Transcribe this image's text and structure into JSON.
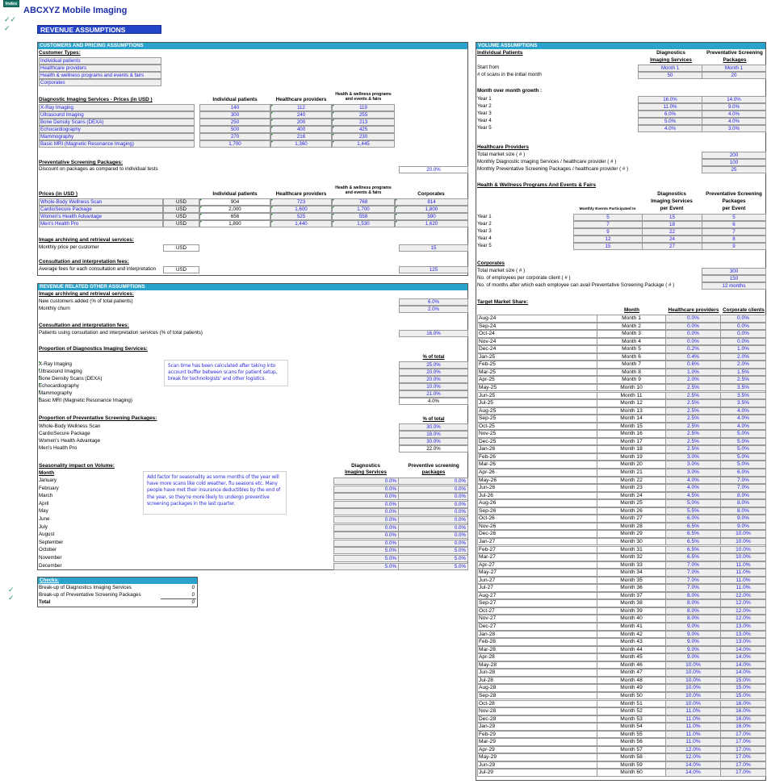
{
  "app": {
    "index_button": "Index",
    "title": "ABCXYZ Mobile Imaging",
    "section_title": "REVENUE ASSUMPTIONS",
    "check_icon": "checkmark-icon"
  },
  "customers_pricing": {
    "header": "CUSTOMERS AND PRICING ASSUMPTIONS",
    "customer_types_title": "Customer Types:",
    "customer_types": [
      "Individual patients",
      "Healthcare providers",
      "Health & wellness programs and events & fairs",
      "Corporates"
    ],
    "diagnostic": {
      "title": "Diagnostic Imaging Services - Prices (in USD )",
      "columns": [
        "Individual patients",
        "Healthcare providers",
        "Health & wellness programs and events & fairs"
      ],
      "rows": [
        {
          "service": "X-Ray Imaging",
          "values": [
            "140",
            "112",
            "119"
          ]
        },
        {
          "service": "Ultrasound Imaging",
          "values": [
            "300",
            "240",
            "255"
          ]
        },
        {
          "service": "Bone Density Scans (DEXA)",
          "values": [
            "250",
            "200",
            "213"
          ]
        },
        {
          "service": "Echocardiography",
          "values": [
            "500",
            "400",
            "425"
          ]
        },
        {
          "service": "Mammography",
          "values": [
            "270",
            "216",
            "230"
          ]
        },
        {
          "service": "Basic MRI (Magnetic Resonance Imaging)",
          "values": [
            "1,700",
            "1,360",
            "1,445"
          ]
        }
      ]
    },
    "packages": {
      "title": "Preventative Screening Packages:",
      "discount_label": "Discount on packages as compared to individual tests",
      "discount_value": "20.0%"
    },
    "prices": {
      "title": "Prices (in USD )",
      "columns": [
        "Individual patients",
        "Healthcare providers",
        "Health & wellness programs and events & fairs",
        "Corporates"
      ],
      "rows": [
        {
          "package": "Whole-Body Wellness Scan",
          "currency": "USD",
          "values": [
            "904",
            "723",
            "768",
            "814"
          ]
        },
        {
          "package": "CardioSecure Package",
          "currency": "USD",
          "values": [
            "2,000",
            "1,600",
            "1,700",
            "1,800"
          ]
        },
        {
          "package": "Women's Health Advantage",
          "currency": "USD",
          "values": [
            "656",
            "525",
            "558",
            "590"
          ]
        },
        {
          "package": "Men's Health Pro",
          "currency": "USD",
          "values": [
            "1,800",
            "1,440",
            "1,530",
            "1,620"
          ]
        }
      ]
    },
    "archiving": {
      "title": "Image archiving and retrieval services:",
      "label": "Monthly price per customer",
      "currency": "USD",
      "value": "15"
    },
    "consultation": {
      "title": "Consultation and interpretation fees:",
      "label": "Average fees for each consultation and interpretation",
      "currency": "USD",
      "value": "125"
    }
  },
  "other_assumptions": {
    "header": "REVENUE RELATED OTHER ASSUMPTIONS",
    "archiving": {
      "title": "Image archiving and retrieval services:",
      "rows": [
        {
          "label": "New customers added (% of total patients)",
          "value": "6.0%"
        },
        {
          "label": "Monthly churn",
          "value": "2.0%"
        }
      ]
    },
    "consultation": {
      "title": "Consultation and interpretation fees:",
      "label": "Patients using consultation and interpretation services  (% of total patients)",
      "value": "16.0%"
    },
    "diag_proportion": {
      "title": "Proportion of Diagnostics Imaging Services:",
      "col_header": "% of total",
      "rows": [
        {
          "label": "X-Ray Imaging",
          "value": "25.0%"
        },
        {
          "label": "Ultrasound Imaging",
          "value": "20.0%"
        },
        {
          "label": "Bone Density Scans (DEXA)",
          "value": "20.0%"
        },
        {
          "label": "Echocardiography",
          "value": "10.0%"
        },
        {
          "label": "Mammography",
          "value": "21.0%"
        },
        {
          "label": "Basic MRI (Magnetic Resonance Imaging)",
          "value": "4.0%"
        }
      ],
      "note": "Scan time has been calculated  after taking into account buffer between scans for patient setup, break for technologists' and other logistics."
    },
    "pkg_proportion": {
      "title": "Proportion of Preventative Screening Packages:",
      "col_header": "% of total",
      "rows": [
        {
          "label": "Whole-Body Wellness Scan",
          "value": "30.0%"
        },
        {
          "label": "CardioSecure Package",
          "value": "18.0%"
        },
        {
          "label": "Women's Health Advantage",
          "value": "30.0%"
        },
        {
          "label": "Men's Health Pro",
          "value": "22.0%"
        }
      ]
    },
    "seasonality": {
      "title": "Seasonality impact on Volume:",
      "month_header": "Month",
      "col1_line1": "Diagnostics",
      "col1_line2": "Imaging Services",
      "col2_line1": "Preventive screening",
      "col2_line2": "packages",
      "note": "Add factor for seasonality as some months of the year will have more scans like cold weather, flu seasons etc. Many people have met their insurance deductibles by the end of the year, so they're more likely to undergo preventive screening packages  in the last quarter.",
      "rows": [
        {
          "month": "January",
          "diag": "0.0%",
          "pkg": "0.0%"
        },
        {
          "month": "February",
          "diag": "0.0%",
          "pkg": "0.0%"
        },
        {
          "month": "March",
          "diag": "0.0%",
          "pkg": "0.0%"
        },
        {
          "month": "April",
          "diag": "0.0%",
          "pkg": "0.0%"
        },
        {
          "month": "May",
          "diag": "0.0%",
          "pkg": "0.0%"
        },
        {
          "month": "June",
          "diag": "0.0%",
          "pkg": "0.0%"
        },
        {
          "month": "July",
          "diag": "0.0%",
          "pkg": "0.0%"
        },
        {
          "month": "August",
          "diag": "0.0%",
          "pkg": "0.0%"
        },
        {
          "month": "September",
          "diag": "0.0%",
          "pkg": "0.0%"
        },
        {
          "month": "October",
          "diag": "5.0%",
          "pkg": "5.0%"
        },
        {
          "month": "November",
          "diag": "5.0%",
          "pkg": "5.0%"
        },
        {
          "month": "December",
          "diag": "5.0%",
          "pkg": "5.0%"
        }
      ]
    }
  },
  "checks": {
    "header": "Checks:",
    "rows": [
      {
        "label": "Break-up of Diagnostics Imaging Services",
        "value": "0"
      },
      {
        "label": "Break-up of Preventative Screening Packages",
        "value": "0"
      }
    ],
    "total_label": "Total",
    "total_value": "0"
  },
  "volume": {
    "header": "VOLUME ASSUMPTIONS",
    "individual": {
      "title": "Individual Patients",
      "col1_line1": "Diagnostics",
      "col1_line2": "Imaging Services",
      "col2_line1": "Preventative Screening",
      "col2_line2": "Packages",
      "start_label": "Start from",
      "start_values": [
        "Month 1",
        "Month 1"
      ],
      "initial_label": "# of scans in the initial month",
      "initial_values": [
        "50",
        "20"
      ],
      "growth_title": "Month over month growth :",
      "growth": [
        {
          "year": "Year 1",
          "diag": "16.0%",
          "pkg": "14.0%"
        },
        {
          "year": "Year 2",
          "diag": "11.0%",
          "pkg": "9.0%"
        },
        {
          "year": "Year 3",
          "diag": "6.0%",
          "pkg": "4.0%"
        },
        {
          "year": "Year 4",
          "diag": "5.0%",
          "pkg": "4.0%"
        },
        {
          "year": "Year 5",
          "diag": "4.0%",
          "pkg": "3.0%"
        }
      ]
    },
    "providers": {
      "title": "Healthcare Providers",
      "rows": [
        {
          "label": "Total market size ( # )",
          "value": "200"
        },
        {
          "label": "Monthly Diagnostic Imaging Services / healthcare provider ( # )",
          "value": "100"
        },
        {
          "label": "Monthly Preventative Screening Packages / healthcare provider ( # )",
          "value": "25"
        }
      ]
    },
    "wellness": {
      "title": "Health & Wellness Programs And Events & Fairs",
      "col0": "Monthly Events Participated In",
      "col1_lines": [
        "Diagnostics",
        "Imaging Services",
        "per Event"
      ],
      "col2_lines": [
        "Preventative Screening",
        "Packages",
        "per Event"
      ],
      "rows": [
        {
          "year": "Year 1",
          "events": "5",
          "diag": "15",
          "pkg": "5"
        },
        {
          "year": "Year 2",
          "events": "7",
          "diag": "18",
          "pkg": "6"
        },
        {
          "year": "Year 3",
          "events": "9",
          "diag": "22",
          "pkg": "7"
        },
        {
          "year": "Year 4",
          "events": "12",
          "diag": "24",
          "pkg": "8"
        },
        {
          "year": "Year 5",
          "events": "15",
          "diag": "27",
          "pkg": "9"
        }
      ]
    },
    "corporates": {
      "title": "Corporates",
      "rows": [
        {
          "label": "Total market size ( # )",
          "value": "300"
        },
        {
          "label": "No. of employees per corporate client ( # )",
          "value": "150"
        },
        {
          "label": "No. of months after which each employee can avail Preventative Screening Package ( # )",
          "value": "12 months"
        }
      ]
    },
    "target_market_share": {
      "title": "Target Market Share:",
      "columns": [
        "Month",
        "Healthcare providers",
        "Corporate clients"
      ],
      "rows": [
        [
          "Aug-24",
          "Month 1",
          "0.0%",
          "0.0%"
        ],
        [
          "Sep-24",
          "Month 2",
          "0.0%",
          "0.0%"
        ],
        [
          "Oct-24",
          "Month 3",
          "0.0%",
          "0.0%"
        ],
        [
          "Nov-24",
          "Month 4",
          "0.0%",
          "0.0%"
        ],
        [
          "Dec-24",
          "Month 5",
          "0.2%",
          "1.0%"
        ],
        [
          "Jan-25",
          "Month 6",
          "0.4%",
          "2.0%"
        ],
        [
          "Feb-25",
          "Month 7",
          "0.6%",
          "2.0%"
        ],
        [
          "Mar-25",
          "Month 8",
          "1.0%",
          "1.5%"
        ],
        [
          "Apr-25",
          "Month 9",
          "2.0%",
          "2.5%"
        ],
        [
          "May-25",
          "Month 10",
          "2.5%",
          "3.5%"
        ],
        [
          "Jun-25",
          "Month 11",
          "2.5%",
          "3.5%"
        ],
        [
          "Jul-25",
          "Month 12",
          "2.5%",
          "3.5%"
        ],
        [
          "Aug-25",
          "Month 13",
          "2.5%",
          "4.0%"
        ],
        [
          "Sep-25",
          "Month 14",
          "2.5%",
          "4.0%"
        ],
        [
          "Oct-25",
          "Month 15",
          "2.5%",
          "4.0%"
        ],
        [
          "Nov-25",
          "Month 16",
          "2.5%",
          "5.0%"
        ],
        [
          "Dec-25",
          "Month 17",
          "2.5%",
          "5.0%"
        ],
        [
          "Jan-26",
          "Month 18",
          "2.5%",
          "5.0%"
        ],
        [
          "Feb-26",
          "Month 19",
          "3.0%",
          "5.0%"
        ],
        [
          "Mar-26",
          "Month 20",
          "3.0%",
          "5.0%"
        ],
        [
          "Apr-26",
          "Month 21",
          "3.0%",
          "6.0%"
        ],
        [
          "May-26",
          "Month 22",
          "4.0%",
          "7.0%"
        ],
        [
          "Jun-26",
          "Month 23",
          "4.0%",
          "7.0%"
        ],
        [
          "Jul-26",
          "Month 24",
          "4.5%",
          "8.0%"
        ],
        [
          "Aug-26",
          "Month 25",
          "5.0%",
          "8.0%"
        ],
        [
          "Sep-26",
          "Month 26",
          "5.5%",
          "8.0%"
        ],
        [
          "Oct-26",
          "Month 27",
          "6.0%",
          "9.0%"
        ],
        [
          "Nov-26",
          "Month 28",
          "6.5%",
          "9.0%"
        ],
        [
          "Dec-26",
          "Month 29",
          "6.5%",
          "10.0%"
        ],
        [
          "Jan-27",
          "Month 30",
          "6.5%",
          "10.0%"
        ],
        [
          "Feb-27",
          "Month 31",
          "6.5%",
          "10.0%"
        ],
        [
          "Mar-27",
          "Month 32",
          "6.5%",
          "10.0%"
        ],
        [
          "Apr-27",
          "Month 33",
          "7.0%",
          "11.0%"
        ],
        [
          "May-27",
          "Month 34",
          "7.0%",
          "11.0%"
        ],
        [
          "Jun-27",
          "Month 35",
          "7.0%",
          "11.0%"
        ],
        [
          "Jul-27",
          "Month 36",
          "7.0%",
          "11.0%"
        ],
        [
          "Aug-27",
          "Month 37",
          "8.0%",
          "12.0%"
        ],
        [
          "Sep-27",
          "Month 38",
          "8.0%",
          "12.0%"
        ],
        [
          "Oct-27",
          "Month 39",
          "8.0%",
          "12.0%"
        ],
        [
          "Nov-27",
          "Month 40",
          "8.0%",
          "12.0%"
        ],
        [
          "Dec-27",
          "Month 41",
          "9.0%",
          "13.0%"
        ],
        [
          "Jan-28",
          "Month 42",
          "9.0%",
          "13.0%"
        ],
        [
          "Feb-28",
          "Month 43",
          "9.0%",
          "13.0%"
        ],
        [
          "Mar-28",
          "Month 44",
          "9.0%",
          "14.0%"
        ],
        [
          "Apr-28",
          "Month 45",
          "9.0%",
          "14.0%"
        ],
        [
          "May-28",
          "Month 46",
          "10.0%",
          "14.0%"
        ],
        [
          "Jun-28",
          "Month 47",
          "10.0%",
          "14.0%"
        ],
        [
          "Jul-28",
          "Month 48",
          "10.0%",
          "15.0%"
        ],
        [
          "Aug-28",
          "Month 49",
          "10.0%",
          "15.0%"
        ],
        [
          "Sep-28",
          "Month 50",
          "10.0%",
          "15.0%"
        ],
        [
          "Oct-28",
          "Month 51",
          "10.0%",
          "16.0%"
        ],
        [
          "Nov-28",
          "Month 52",
          "11.0%",
          "16.0%"
        ],
        [
          "Dec-28",
          "Month 53",
          "11.0%",
          "16.0%"
        ],
        [
          "Jan-29",
          "Month 54",
          "11.0%",
          "16.0%"
        ],
        [
          "Feb-29",
          "Month 55",
          "11.0%",
          "17.0%"
        ],
        [
          "Mar-29",
          "Month 56",
          "11.0%",
          "17.0%"
        ],
        [
          "Apr-29",
          "Month 57",
          "12.0%",
          "17.0%"
        ],
        [
          "May-29",
          "Month 58",
          "12.0%",
          "17.0%"
        ],
        [
          "Jun-29",
          "Month 59",
          "14.0%",
          "17.0%"
        ],
        [
          "Jul-29",
          "Month 60",
          "14.0%",
          "17.0%"
        ]
      ]
    }
  }
}
